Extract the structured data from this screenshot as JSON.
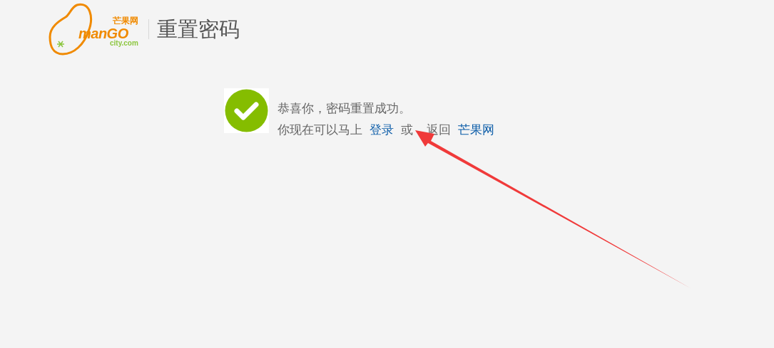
{
  "logo": {
    "brand_cn": "芒果网",
    "brand_main": "manGO",
    "brand_sub": "city.com"
  },
  "page_title": "重置密码",
  "message": {
    "headline": "恭喜你，密码重置成功。",
    "lead": "你现在可以马上",
    "login_link": "登录",
    "middle_start": "或",
    "middle_end": "返回",
    "home_link": "芒果网"
  }
}
